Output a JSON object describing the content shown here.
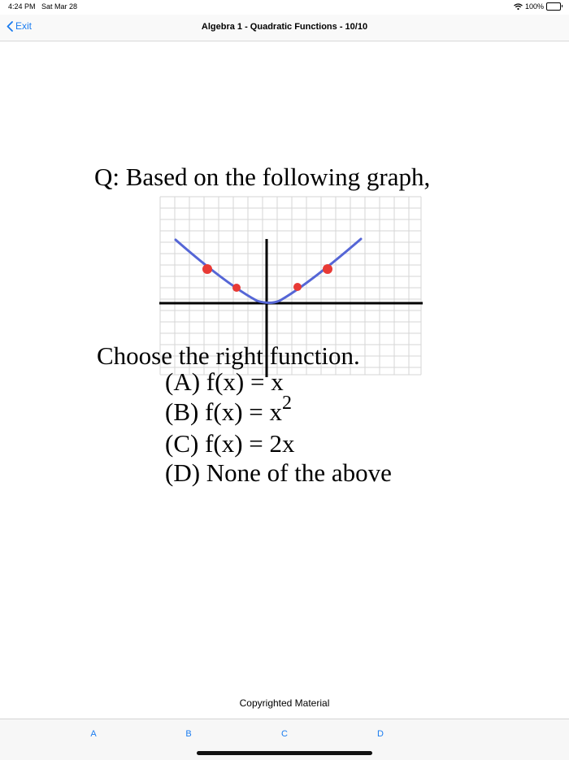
{
  "status": {
    "time": "4:24 PM",
    "date": "Sat Mar 28",
    "battery": "100%",
    "icons": [
      "wifi-icon",
      "battery-icon"
    ]
  },
  "nav": {
    "back_label": "Exit",
    "title": "Algebra 1 - Quadratic Functions - 10/10"
  },
  "question": {
    "prompt": "Q: Based on the following graph,",
    "instruction": "Choose the right  function.",
    "options": [
      {
        "text": "(A) f(x) = x"
      },
      {
        "text": "(B) f(x) = x",
        "sup": "2"
      },
      {
        "text": "(C) f(x) = 2x"
      },
      {
        "text": "(D) None of the above"
      }
    ],
    "graph_colors": {
      "curve": "#5566d6",
      "points": "#e83a35",
      "axes": "#000000",
      "grid": "#d6d6d6"
    }
  },
  "footer": {
    "copyright": "Copyrighted Material"
  },
  "tabs": [
    "A",
    "B",
    "C",
    "D"
  ],
  "accent_color": "#1a7cf0"
}
